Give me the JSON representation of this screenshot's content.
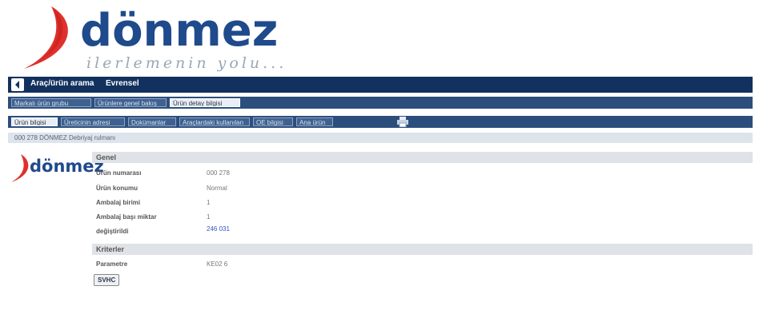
{
  "brand": {
    "name": "dönmez",
    "slogan": "ilerlemenin yolu...",
    "colors": {
      "primary": "#1f4a8c",
      "swoosh": "#e0302c"
    }
  },
  "navbar": {
    "back_icon": "back-arrow-icon",
    "title": "Araç/ürün arama",
    "context": "Evrensel"
  },
  "tabs_row1": [
    {
      "label": "Markalı ürün grubu",
      "active": false
    },
    {
      "label": "Ürünlere genel bakış",
      "active": false
    },
    {
      "label": "Ürün detay bilgisi",
      "active": true
    }
  ],
  "tabs_row2": [
    {
      "label": "Ürün bilgisi",
      "active": true
    },
    {
      "label": "Üreticinin adresi",
      "active": false
    },
    {
      "label": "Dokümanlar",
      "active": false
    },
    {
      "label": "Araçlardaki kullanılan",
      "active": false
    },
    {
      "label": "OE bilgisi",
      "active": false
    },
    {
      "label": "Ana ürün",
      "active": false
    }
  ],
  "print_icon": "printer-icon",
  "breadcrumb": "000 278 DÖNMEZ Debriyaj rulmanı",
  "sections": {
    "genel": {
      "title": "Genel",
      "fields": [
        {
          "label": "Ürün numarası",
          "value": "000 278",
          "link": false
        },
        {
          "label": "Ürün konumu",
          "value": "Normal",
          "link": false
        },
        {
          "label": "Ambalaj birimi",
          "value": "1",
          "link": false
        },
        {
          "label": "Ambalaj başı miktar",
          "value": "1",
          "link": false
        },
        {
          "label": "değiştirildi",
          "value": "246 031",
          "link": true
        }
      ]
    },
    "kriterler": {
      "title": "Kriterler",
      "fields": [
        {
          "label": "Parametre",
          "value": "KE02 6",
          "link": false
        }
      ]
    }
  },
  "bottom_button": "SVHC"
}
